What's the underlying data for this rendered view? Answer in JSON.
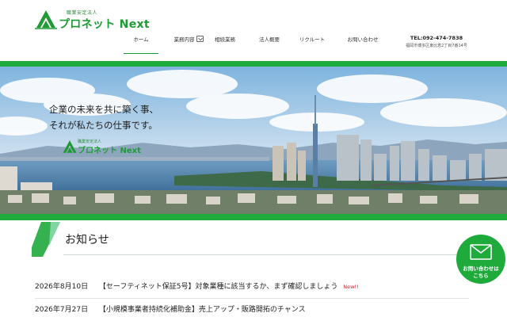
{
  "brand": {
    "sub": "職業安定法人",
    "name": "プロネット Next"
  },
  "nav": [
    {
      "label": "ホーム",
      "active": true
    },
    {
      "label": "業務内容",
      "has_dropdown": true
    },
    {
      "label": "相続業務"
    },
    {
      "label": "法人概要"
    },
    {
      "label": "リクルート"
    },
    {
      "label": "お問い合わせ"
    }
  ],
  "contact": {
    "tel": "TEL:092-474-7838",
    "address": "福岡市博多区東比恵2丁目7番14号"
  },
  "hero": {
    "line1": "企業の未来を共に築く事、",
    "line2": "それが私たちの仕事です。",
    "logo_sub": "職業安定法人",
    "logo_name": "プロネット Next"
  },
  "news": {
    "title": "お知らせ",
    "items": [
      {
        "date": "2026年8月10日",
        "text": "【セーフティネット保証5号】対象業種に該当するか、まず確認しましょう",
        "badge": "New!!"
      },
      {
        "date": "2026年7月27日",
        "text": "【小規模事業者持続化補助金】売上アップ・販路開拓のチャンス",
        "badge": ""
      }
    ]
  },
  "float_button": {
    "line1": "お問い合わせは",
    "line2": "こちら"
  },
  "colors": {
    "brand_green": "#1faa3c",
    "new_red": "#e11d1d"
  }
}
